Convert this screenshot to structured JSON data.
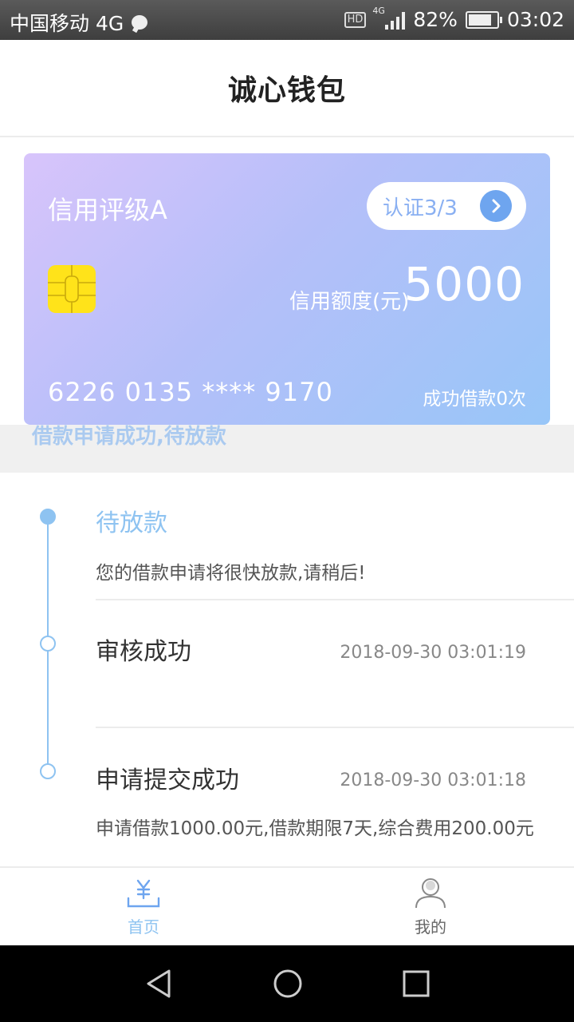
{
  "status_bar": {
    "carrier": "中国移动 4G",
    "hd": "HD",
    "network": "4G",
    "battery": "82%",
    "battery_level": 0.82,
    "time": "03:02"
  },
  "header": {
    "title": "诚心钱包"
  },
  "card": {
    "rating": "信用评级A",
    "cert_button": "认证3/3",
    "limit_label": "信用额度(元)",
    "limit_value": "5000",
    "card_number": "6226 0135 **** 9170",
    "loan_count": "成功借款0次",
    "colors": {
      "gradient_start": "#d8c4fb",
      "gradient_end": "#98c6f8",
      "chip": "#ffe31a"
    }
  },
  "banner": {
    "text": "借款申请成功,待放款"
  },
  "timeline": {
    "accent_color": "#8ec3f1",
    "items": [
      {
        "title": "待放款",
        "desc": "您的借款申请将很快放款,请稍后!",
        "time": ""
      },
      {
        "title": "审核成功",
        "desc": "",
        "time": "2018-09-30 03:01:19"
      },
      {
        "title": "申请提交成功",
        "desc": "申请借款1000.00元,借款期限7天,综合费用200.00元",
        "time": "2018-09-30 03:01:18"
      }
    ]
  },
  "tabbar": {
    "items": [
      {
        "label": "首页",
        "icon": "yuan-wallet-icon",
        "active": true
      },
      {
        "label": "我的",
        "icon": "person-icon",
        "active": false
      }
    ]
  },
  "nav": {
    "back": "back-triangle-icon",
    "home": "home-circle-icon",
    "recents": "recents-square-icon"
  }
}
